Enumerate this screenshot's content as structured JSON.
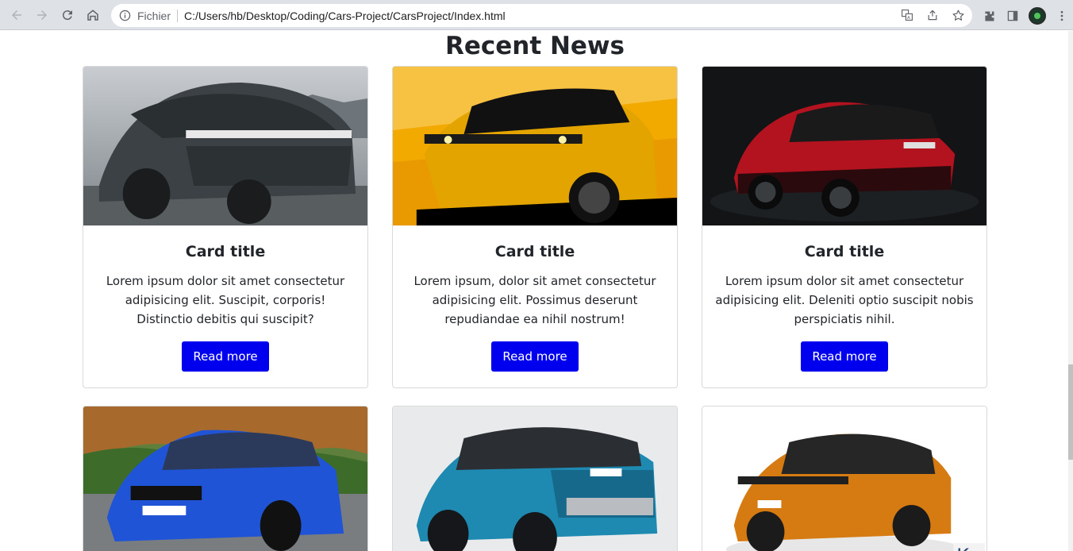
{
  "browser": {
    "scheme_label": "Fichier",
    "url": "C:/Users/hb/Desktop/Coding/Cars-Project/CarsProject/Index.html",
    "icons": [
      "back-icon",
      "forward-icon",
      "reload-icon",
      "home-icon",
      "info-icon",
      "translate-icon",
      "share-icon",
      "star-icon",
      "extensions-icon",
      "sidepanel-icon",
      "profile-avatar",
      "menu-icon"
    ]
  },
  "section": {
    "heading": "Recent News"
  },
  "cards": [
    {
      "title": "Card title",
      "text": "Lorem ipsum dolor sit amet consectetur adipisicing elit. Suscipit, corporis! Distinctio debitis qui suscipit?",
      "button": "Read more",
      "image": "dark-grey-suv"
    },
    {
      "title": "Card title",
      "text": "Lorem ipsum, dolor sit amet consectetur adipisicing elit. Possimus deserunt repudiandae ea nihil nostrum!",
      "button": "Read more",
      "image": "yellow-suv-sketch"
    },
    {
      "title": "Card title",
      "text": "Lorem ipsum dolor sit amet consectetur adipisicing elit. Deleniti optio suscipit nobis perspiciatis nihil.",
      "button": "Read more",
      "image": "red-suv"
    },
    {
      "image": "blue-sedan"
    },
    {
      "image": "teal-suv"
    },
    {
      "image": "orange-suv"
    }
  ],
  "colors": {
    "button": "#0000ee",
    "chrome": "#dee1e6"
  }
}
